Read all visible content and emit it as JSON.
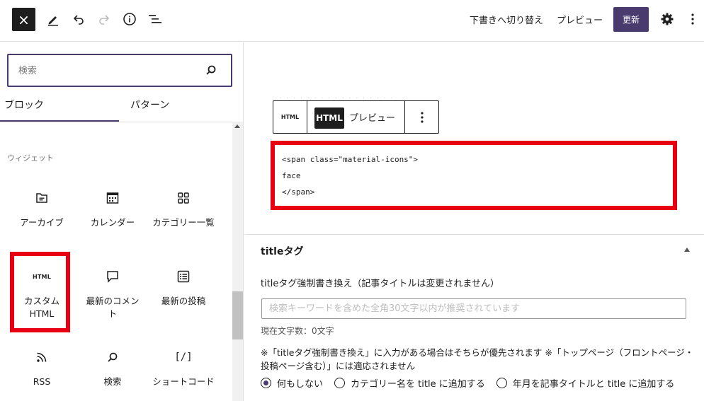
{
  "topbar": {
    "close_icon": "×",
    "switch_draft": "下書きへ切り替え",
    "preview": "プレビュー",
    "update": "更新"
  },
  "inserter": {
    "search_placeholder": "検索",
    "tabs": [
      "ブロック",
      "パターン"
    ],
    "category": "ウィジェット",
    "blocks": [
      {
        "label": "アーカイブ",
        "icon": "archive-icon"
      },
      {
        "label": "カレンダー",
        "icon": "calendar-icon"
      },
      {
        "label": "カテゴリー一覧",
        "icon": "categories-icon"
      },
      {
        "label": "カスタムHTML",
        "icon": "html-icon",
        "glyph": "HTML"
      },
      {
        "label": "最新のコメント",
        "icon": "comment-icon"
      },
      {
        "label": "最新の投稿",
        "icon": "posts-list-icon"
      },
      {
        "label": "RSS",
        "icon": "rss-icon"
      },
      {
        "label": "検索",
        "icon": "search-icon"
      },
      {
        "label": "ショートコード",
        "icon": "shortcode-icon",
        "glyph": "[/]"
      }
    ]
  },
  "html_block": {
    "type_glyph": "HTML",
    "html_tab": "HTML",
    "preview_tab": "プレビュー",
    "code_lines": [
      "<span class=\"material-icons\">",
      "face",
      "</span>"
    ]
  },
  "meta": {
    "title": "titleタグ",
    "label": "titleタグ強制書き換え（記事タイトルは変更されません）",
    "placeholder": "検索キーワードを含めた全角30文字以内が推奨されています",
    "count": "現在文字数：0文字",
    "note": "※「titleタグ強制書き換え」に入力がある場合はそちらが優先されます ※「トップページ（フロントページ・投稿ページ含む）」には適応されません",
    "options": [
      "何もしない",
      "カテゴリー名を title に追加する",
      "年月を記事タイトルと title に追加する"
    ]
  },
  "colors": {
    "accent": "#4a3b6e",
    "highlight_red": "#e60012",
    "dark": "#1e1e1e"
  }
}
